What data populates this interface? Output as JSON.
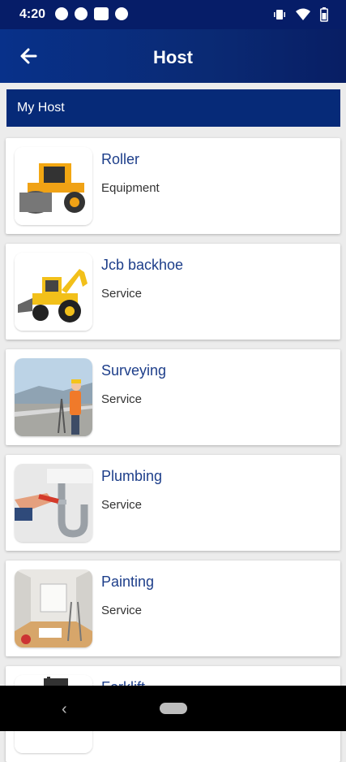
{
  "status": {
    "time": "4:20"
  },
  "appbar": {
    "title": "Host",
    "back_icon": "arrow-left-icon"
  },
  "section": {
    "title": "My Host"
  },
  "items": [
    {
      "title": "Roller",
      "subtitle": "Equipment",
      "image": "roller-image"
    },
    {
      "title": "Jcb backhoe",
      "subtitle": "Service",
      "image": "backhoe-image"
    },
    {
      "title": "Surveying",
      "subtitle": "Service",
      "image": "surveying-image"
    },
    {
      "title": "Plumbing",
      "subtitle": "Service",
      "image": "plumbing-image"
    },
    {
      "title": "Painting",
      "subtitle": "Service",
      "image": "painting-image"
    },
    {
      "title": "Forklift",
      "subtitle": "",
      "image": "forklift-image"
    }
  ],
  "colors": {
    "primary": "#061d68",
    "title_text": "#1d3e8a",
    "background": "#ececec"
  }
}
